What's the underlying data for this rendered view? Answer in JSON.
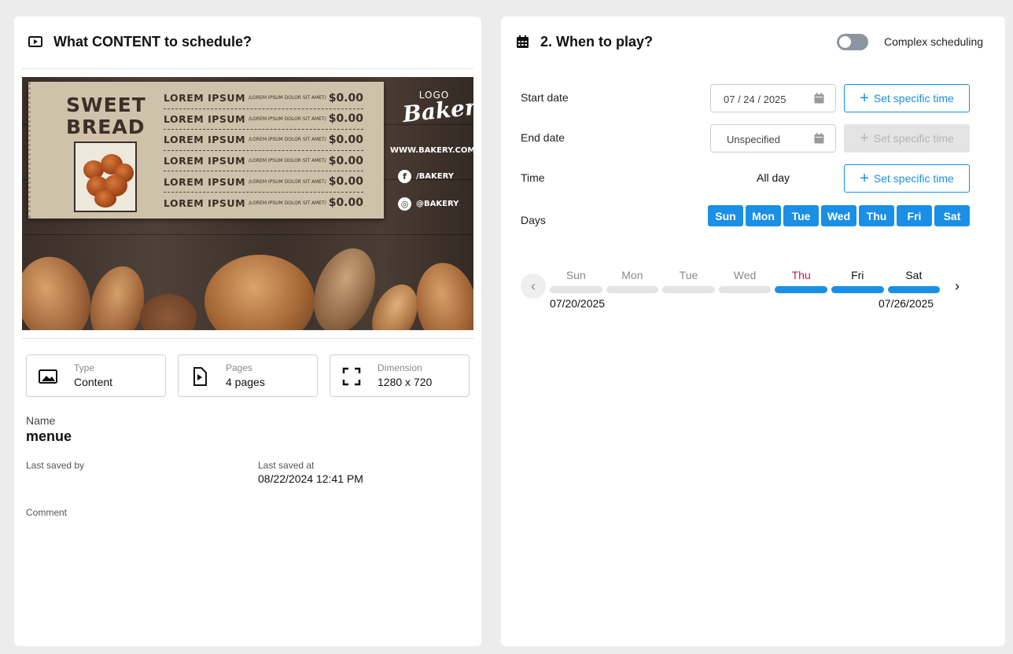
{
  "content_panel": {
    "title": "What CONTENT to schedule?",
    "preview": {
      "headline": "SWEET BREAD",
      "menu_items": [
        {
          "name": "LOREM IPSUM",
          "desc": "/LOREM IPSUM DOLOR SIT AMET/",
          "price": "$0.00"
        },
        {
          "name": "LOREM IPSUM",
          "desc": "/LOREM IPSUM DOLOR SIT AMET/",
          "price": "$0.00"
        },
        {
          "name": "LOREM IPSUM",
          "desc": "/LOREM IPSUM DOLOR SIT AMET/",
          "price": "$0.00"
        },
        {
          "name": "LOREM IPSUM",
          "desc": "/LOREM IPSUM DOLOR SIT AMET/",
          "price": "$0.00"
        },
        {
          "name": "LOREM IPSUM",
          "desc": "/LOREM IPSUM DOLOR SIT AMET/",
          "price": "$0.00"
        },
        {
          "name": "LOREM IPSUM",
          "desc": "/LOREM IPSUM DOLOR SIT AMET/",
          "price": "$0.00"
        }
      ],
      "logo_small": "LOGO",
      "logo_main": "Bakery",
      "website": "WWW.BAKERY.COM",
      "facebook": "/BAKERY",
      "instagram": "@BAKERY"
    },
    "cards": [
      {
        "key": "Type",
        "value": "Content",
        "icon": "image-icon"
      },
      {
        "key": "Pages",
        "value": "4 pages",
        "icon": "file-play-icon"
      },
      {
        "key": "Dimension",
        "value": "1280 x 720",
        "icon": "expand-icon"
      }
    ],
    "name_label": "Name",
    "name_value": "menue",
    "last_saved_by_label": "Last saved by",
    "last_saved_at_label": "Last saved at",
    "last_saved_at_value": "08/22/2024 12:41 PM",
    "comment_label": "Comment"
  },
  "schedule_panel": {
    "title": "2. When to play?",
    "complex_label": "Complex scheduling",
    "complex_enabled": false,
    "start_label": "Start date",
    "start_value": "07 / 24 / 2025",
    "end_label": "End date",
    "end_placeholder": "Unspecified",
    "time_label": "Time",
    "time_value": "All day",
    "set_time_label": "Set specific time",
    "days_label": "Days",
    "days": [
      "Sun",
      "Mon",
      "Tue",
      "Wed",
      "Thu",
      "Fri",
      "Sat"
    ],
    "week": {
      "days": [
        "Sun",
        "Mon",
        "Tue",
        "Wed",
        "Thu",
        "Fri",
        "Sat"
      ],
      "start": "07/20/2025",
      "end": "07/26/2025"
    },
    "colors": {
      "accent": "#1a8fe6",
      "today": "#c2185b"
    }
  }
}
